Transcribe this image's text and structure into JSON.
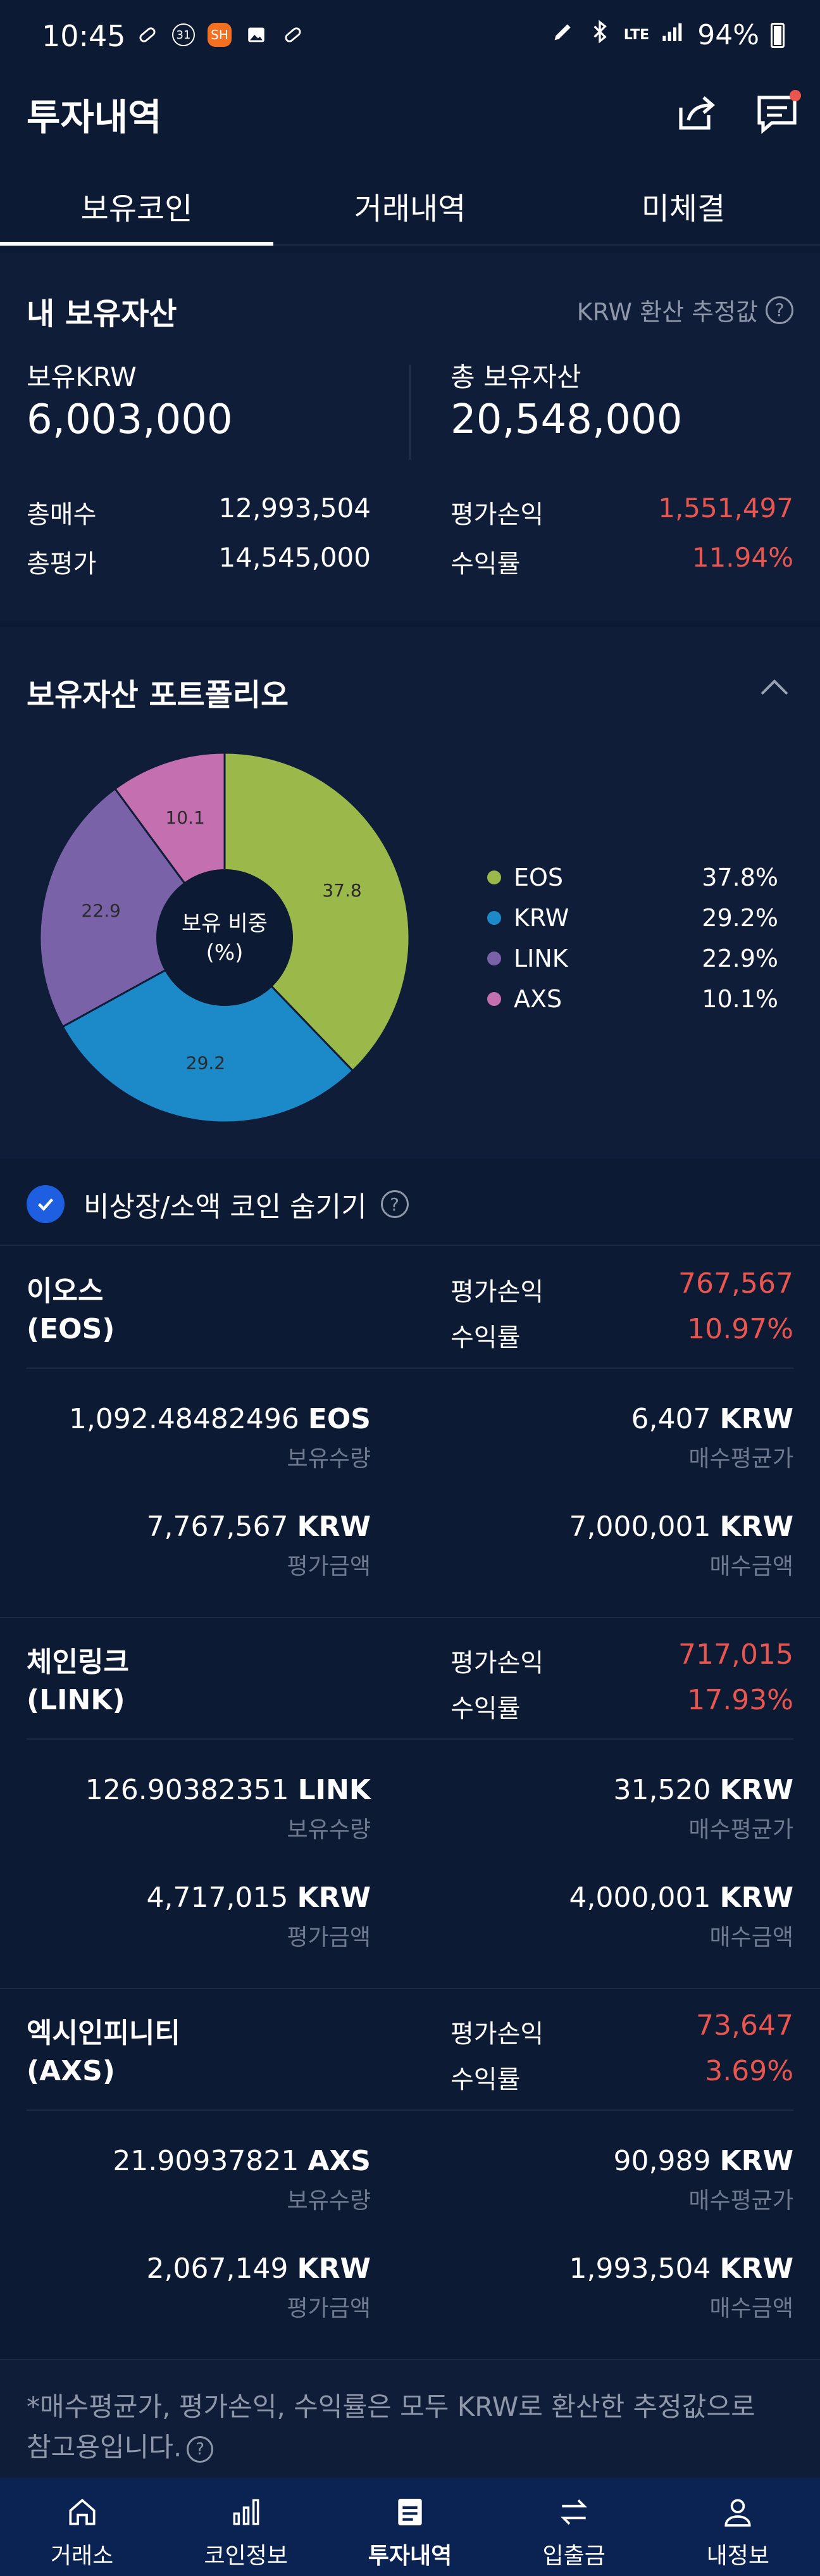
{
  "status_bar": {
    "time": "10:45",
    "battery": "94%",
    "badge_label": "SH",
    "calendar_label": "31",
    "network": "LTE"
  },
  "header": {
    "title": "투자내역"
  },
  "tabs": [
    {
      "label": "보유코인",
      "active": true
    },
    {
      "label": "거래내역",
      "active": false
    },
    {
      "label": "미체결",
      "active": false
    }
  ],
  "assets": {
    "title": "내 보유자산",
    "note": "KRW 환산 추정값",
    "held_krw_label": "보유KRW",
    "held_krw_value": "6,003,000",
    "total_label": "총 보유자산",
    "total_value": "20,548,000",
    "buy_label": "총매수",
    "buy_value": "12,993,504",
    "eval_label": "총평가",
    "eval_value": "14,545,000",
    "pl_label": "평가손익",
    "pl_value": "1,551,497",
    "roi_label": "수익률",
    "roi_value": "11.94%"
  },
  "portfolio": {
    "title": "보유자산 포트폴리오",
    "center_label_line1": "보유 비중",
    "center_label_line2": "(%)",
    "legend": [
      {
        "name": "EOS",
        "value": "37.8%"
      },
      {
        "name": "KRW",
        "value": "29.2%"
      },
      {
        "name": "LINK",
        "value": "22.9%"
      },
      {
        "name": "AXS",
        "value": "10.1%"
      }
    ]
  },
  "chart_data": {
    "type": "pie",
    "categories": [
      "EOS",
      "KRW",
      "LINK",
      "AXS"
    ],
    "values": [
      37.8,
      29.2,
      22.9,
      10.1
    ],
    "labels": [
      "37.8",
      "29.2",
      "22.9",
      "10.1"
    ],
    "colors": [
      "#9bb84b",
      "#1c89c8",
      "#7a62a9",
      "#c46fb0"
    ],
    "legend_position": "right"
  },
  "hide_small": {
    "label": "비상장/소액 코인 숨기기",
    "checked": true
  },
  "coins": [
    {
      "name_kr": "이오스",
      "name_code": "(EOS)",
      "pl_label": "평가손익",
      "pl_value": "767,567",
      "roi_label": "수익률",
      "roi_value": "10.97%",
      "qty_num": "1,092.48482496",
      "qty_unit": "EOS",
      "qty_caption": "보유수량",
      "avg_num": "6,407",
      "avg_unit": "KRW",
      "avg_caption": "매수평균가",
      "eval_num": "7,767,567",
      "eval_unit": "KRW",
      "eval_caption": "평가금액",
      "buy_num": "7,000,001",
      "buy_unit": "KRW",
      "buy_caption": "매수금액"
    },
    {
      "name_kr": "체인링크",
      "name_code": "(LINK)",
      "pl_label": "평가손익",
      "pl_value": "717,015",
      "roi_label": "수익률",
      "roi_value": "17.93%",
      "qty_num": "126.90382351",
      "qty_unit": "LINK",
      "qty_caption": "보유수량",
      "avg_num": "31,520",
      "avg_unit": "KRW",
      "avg_caption": "매수평균가",
      "eval_num": "4,717,015",
      "eval_unit": "KRW",
      "eval_caption": "평가금액",
      "buy_num": "4,000,001",
      "buy_unit": "KRW",
      "buy_caption": "매수금액"
    },
    {
      "name_kr": "엑시인피니티",
      "name_code": "(AXS)",
      "pl_label": "평가손익",
      "pl_value": "73,647",
      "roi_label": "수익률",
      "roi_value": "3.69%",
      "qty_num": "21.90937821",
      "qty_unit": "AXS",
      "qty_caption": "보유수량",
      "avg_num": "90,989",
      "avg_unit": "KRW",
      "avg_caption": "매수평균가",
      "eval_num": "2,067,149",
      "eval_unit": "KRW",
      "eval_caption": "평가금액",
      "buy_num": "1,993,504",
      "buy_unit": "KRW",
      "buy_caption": "매수금액"
    }
  ],
  "footnote": {
    "line1": "*매수평균가, 평가손익, 수익률은 모두 KRW로 환산한 추정값으로",
    "line2": "참고용입니다."
  },
  "bottom_nav": [
    {
      "label": "거래소",
      "icon": "home-icon",
      "active": false
    },
    {
      "label": "코인정보",
      "icon": "bar-chart-icon",
      "active": false
    },
    {
      "label": "투자내역",
      "icon": "document-icon",
      "active": true
    },
    {
      "label": "입출금",
      "icon": "transfer-icon",
      "active": false
    },
    {
      "label": "내정보",
      "icon": "person-icon",
      "active": false
    }
  ]
}
